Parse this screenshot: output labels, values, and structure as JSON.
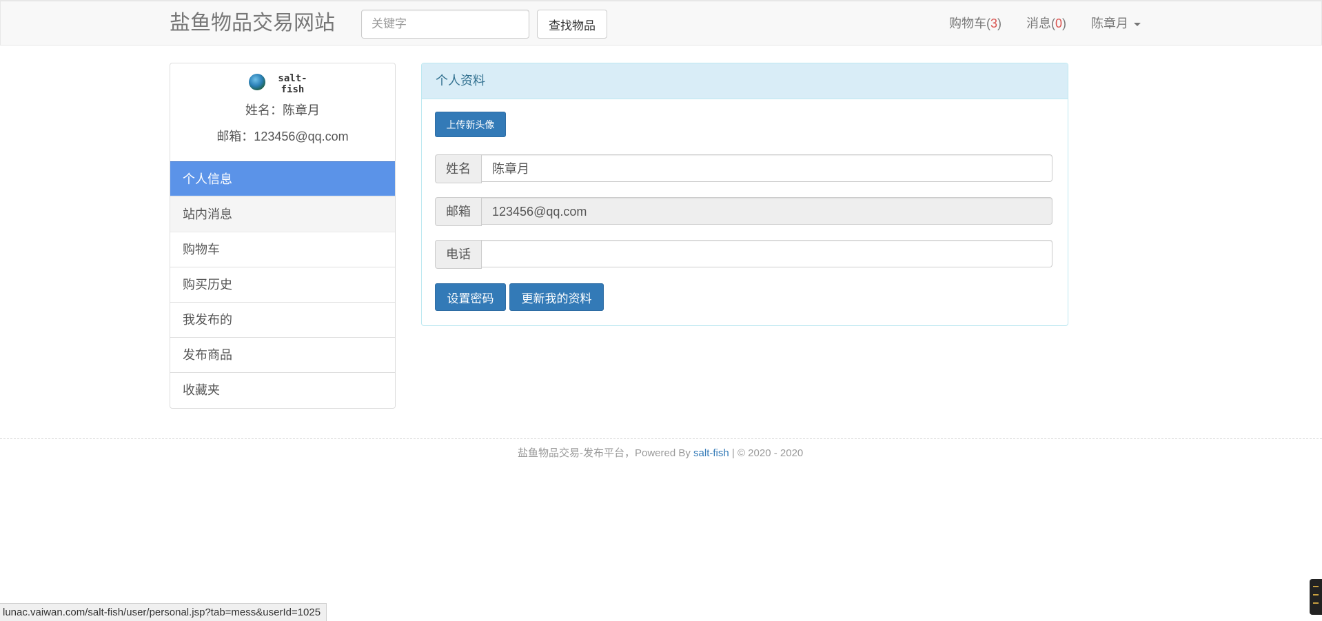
{
  "navbar": {
    "brand": "盐鱼物品交易网站",
    "search_placeholder": "关键字",
    "search_button": "查找物品",
    "cart_label": "购物车(",
    "cart_count": "3",
    "cart_close": ")",
    "messages_label": "消息(",
    "messages_count": "0",
    "messages_close": ")",
    "user_name": "陈章月"
  },
  "sidebar": {
    "logo_text": "salt-fish",
    "name_line": "姓名：陈章月",
    "email_line": "邮箱：123456@qq.com",
    "items": [
      {
        "label": "个人信息"
      },
      {
        "label": "站内消息"
      },
      {
        "label": "购物车"
      },
      {
        "label": "购买历史"
      },
      {
        "label": "我发布的"
      },
      {
        "label": "发布商品"
      },
      {
        "label": "收藏夹"
      }
    ]
  },
  "panel": {
    "title": "个人资料",
    "upload_button": "上传新头像",
    "fields": [
      {
        "label": "姓名",
        "value": "陈章月"
      },
      {
        "label": "邮箱",
        "value": "123456@qq.com"
      },
      {
        "label": "电话",
        "value": ""
      }
    ],
    "set_password_button": "设置密码",
    "update_button": "更新我的资料"
  },
  "footer": {
    "text_prefix": "盐鱼物品交易-发布平台，Powered By ",
    "link_text": "salt-fish",
    "text_suffix": " | © 2020 - 2020"
  },
  "statusbar": {
    "url": "lunac.vaiwan.com/salt-fish/user/personal.jsp?tab=mess&userId=1025"
  },
  "colors": {
    "primary": "#337ab7",
    "active_menu": "#5b93e8",
    "panel_heading_bg": "#d9edf7",
    "count_red": "#d9534f"
  }
}
